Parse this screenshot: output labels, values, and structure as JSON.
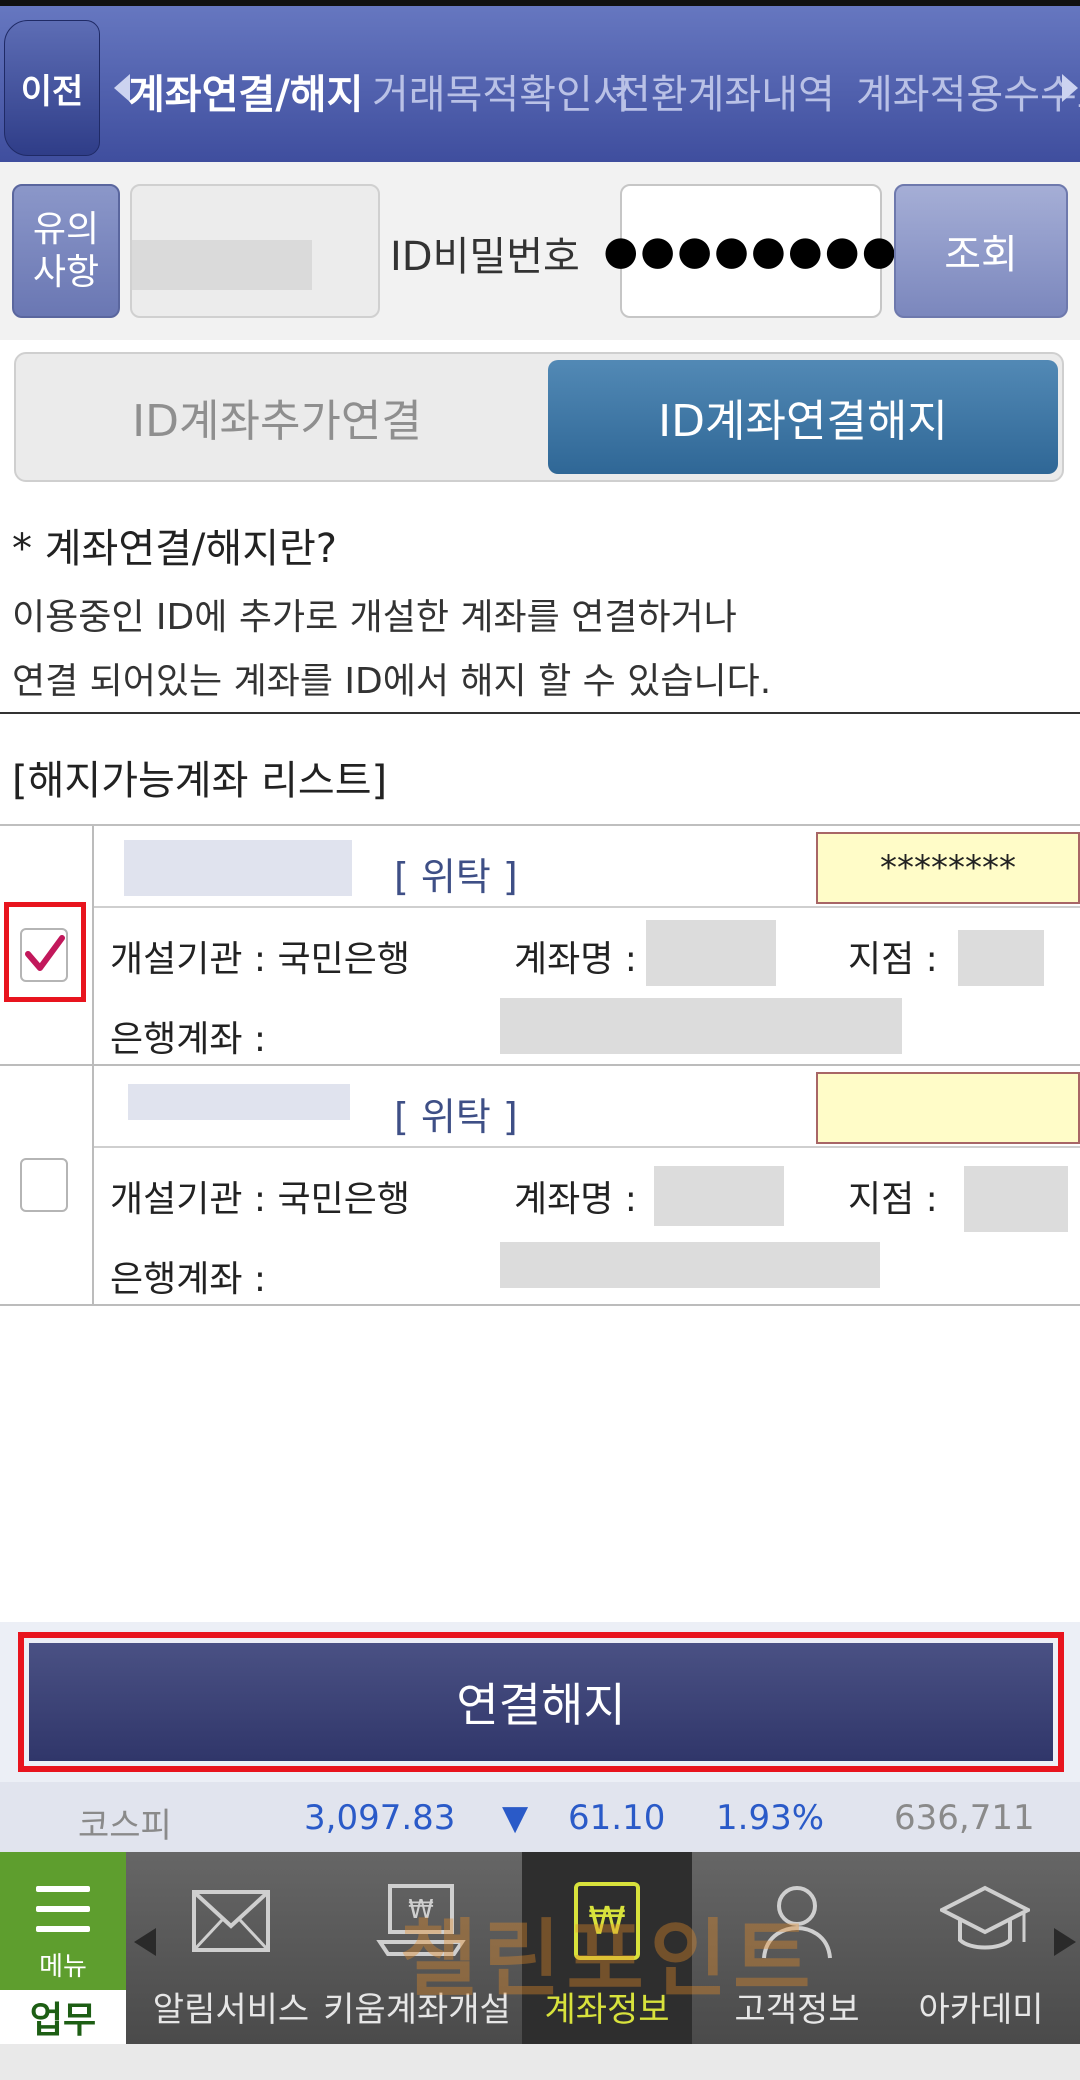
{
  "top_tabs": {
    "back_label": "이전",
    "tabs": [
      "계좌연결/해지",
      "거래목적확인서",
      "전환계좌내역",
      "계좌적용수수료"
    ]
  },
  "login": {
    "notice_label": "유의\n사항",
    "pw_label": "ID비밀번호",
    "pw_value": "●●●●●●●●",
    "search_label": "조회"
  },
  "segment": {
    "add_label": "ID계좌추가연결",
    "remove_label": "ID계좌연결해지"
  },
  "info": {
    "title": "* 계좌연결/해지란?",
    "line1": "이용중인 ID에 추가로 개설한 계좌를 연결하거나",
    "line2": "연결 되어있는 계좌를 ID에서 해지 할 수 있습니다."
  },
  "list_title": "[해지가능계좌 리스트]",
  "accounts": [
    {
      "type": "[ 위탁 ]",
      "password": "********",
      "institution": "개설기관 : 국민은행",
      "name_label": "계좌명 :",
      "branch_label": "지점 :",
      "bank_account_label": "은행계좌 :",
      "checked": true
    },
    {
      "type": "[ 위탁 ]",
      "password": "",
      "institution": "개설기관 : 국민은행",
      "name_label": "계좌명 :",
      "branch_label": "지점 :",
      "bank_account_label": "은행계좌 :",
      "checked": false
    }
  ],
  "action": {
    "unlink_label": "연결해지"
  },
  "ticker": {
    "name": "코스피",
    "value": "3,097.83",
    "direction": "▼",
    "change": "61.10",
    "percent": "1.93%",
    "volume": "636,711"
  },
  "bottom_nav": {
    "menu_label": "메뉴",
    "work_label": "업무",
    "items": [
      "알림서비스",
      "키움계좌개설",
      "계좌정보",
      "고객정보",
      "아카데미"
    ],
    "active_index": 2
  },
  "watermark": "챌린포인트",
  "colors": {
    "header_blue": "#4a5aa8",
    "segment_active": "#3d77a6",
    "highlight_red": "#e8141e",
    "down_blue": "#2a5ac8",
    "active_nav_text": "#d8e23c",
    "menu_green": "#5e9e2e"
  }
}
